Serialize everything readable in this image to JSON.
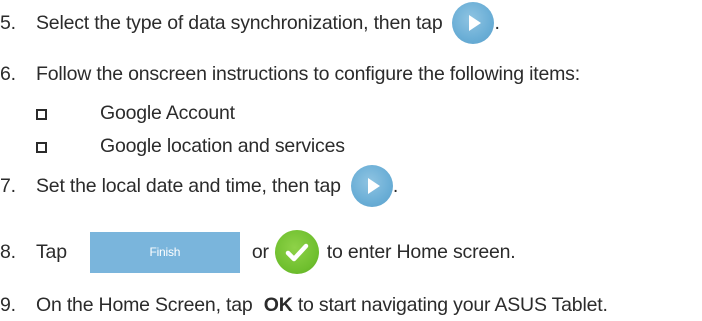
{
  "steps": {
    "s5": {
      "number": "5.",
      "text_before": "Select the type of data synchronization, then tap",
      "text_after": "."
    },
    "s6": {
      "number": "6.",
      "text": "Follow the onscreen instructions to configure the following items:",
      "items": [
        "Google Account",
        "Google location and services"
      ]
    },
    "s7": {
      "number": "7.",
      "text_before": "Set the local date and time, then tap",
      "text_after": "."
    },
    "s8": {
      "number": "8.",
      "text_before": "Tap",
      "finish_label": "Finish",
      "text_or": "or",
      "text_after": "to enter Home screen."
    },
    "s9": {
      "number": "9.",
      "text_before": "On the Home Screen, tap",
      "bold": "OK",
      "text_after": "to start navigating your ASUS Tablet."
    }
  },
  "icons": {
    "next": "play-arrow-icon",
    "done": "checkmark-icon",
    "bullet": "checkbox-icon"
  },
  "colors": {
    "next_button": "#6aaed6",
    "finish_button": "#7ab5dc",
    "done_button": "#6fbf2e",
    "text": "#2b2b2b"
  }
}
